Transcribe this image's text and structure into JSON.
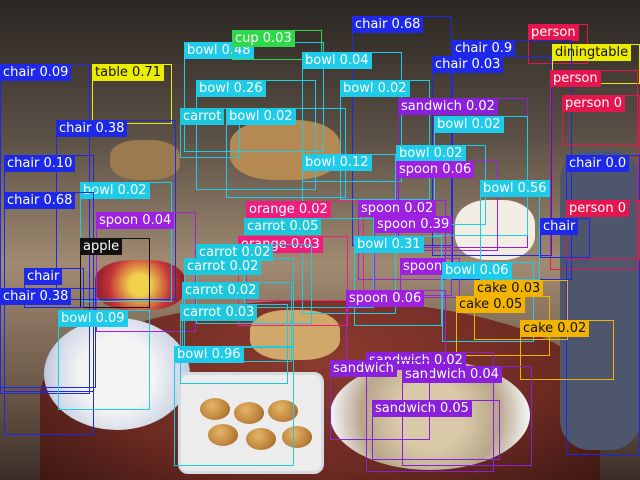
{
  "colors": {
    "chair": "#1d28e8",
    "person": "#e5164f",
    "bowl": "#1ecbe8",
    "diningtable": "#ecec00",
    "cup": "#2ed84a",
    "sandwich": "#8a1fdc",
    "spoon": "#9e20e0",
    "orange": "#ee1e7e",
    "carrot": "#1ec8dc",
    "apple": "#111111",
    "cake": "#f2b400",
    "pizza": "#1e72e8"
  },
  "detections": [
    {
      "cls": "chair",
      "text": "chair 0.68"
    },
    {
      "cls": "person",
      "text": "person"
    },
    {
      "cls": "diningtable",
      "text": "diningtable"
    },
    {
      "cls": "bowl",
      "text": "bowl 0.48"
    },
    {
      "cls": "cup",
      "text": "cup 0.03"
    },
    {
      "cls": "chair",
      "text": "chair 0.9"
    },
    {
      "cls": "bowl",
      "text": "bowl 0.04"
    },
    {
      "cls": "chair",
      "text": "chair 0.03"
    },
    {
      "cls": "chair",
      "text": "chair 0.09"
    },
    {
      "cls": "diningtable",
      "text": "table 0.71"
    },
    {
      "cls": "person",
      "text": "person"
    },
    {
      "cls": "bowl",
      "text": "bowl 0.26"
    },
    {
      "cls": "bowl",
      "text": "bowl 0.02"
    },
    {
      "cls": "person",
      "text": "person 0"
    },
    {
      "cls": "sandwich",
      "text": "sandwich 0.02"
    },
    {
      "cls": "carrot",
      "text": "carrot"
    },
    {
      "cls": "bowl",
      "text": "bowl 0.02"
    },
    {
      "cls": "bowl",
      "text": "bowl 0.02"
    },
    {
      "cls": "chair",
      "text": "chair 0.38"
    },
    {
      "cls": "bowl",
      "text": "bowl 0.12"
    },
    {
      "cls": "bowl",
      "text": "bowl 0.02"
    },
    {
      "cls": "chair",
      "text": "chair 0.10"
    },
    {
      "cls": "chair",
      "text": "chair 0.0"
    },
    {
      "cls": "spoon",
      "text": "spoon 0.06"
    },
    {
      "cls": "bowl",
      "text": "bowl 0.56"
    },
    {
      "cls": "bowl",
      "text": "bowl 0.02"
    },
    {
      "cls": "chair",
      "text": "chair 0.68"
    },
    {
      "cls": "spoon",
      "text": "spoon 0.04"
    },
    {
      "cls": "orange",
      "text": "orange 0.02"
    },
    {
      "cls": "spoon",
      "text": "spoon 0.02"
    },
    {
      "cls": "person",
      "text": "person 0"
    },
    {
      "cls": "carrot",
      "text": "carrot 0.05"
    },
    {
      "cls": "spoon",
      "text": "spoon 0.39"
    },
    {
      "cls": "apple",
      "text": "apple"
    },
    {
      "cls": "chair",
      "text": "chair"
    },
    {
      "cls": "orange",
      "text": "orange 0.03"
    },
    {
      "cls": "bowl",
      "text": "bowl 0.31"
    },
    {
      "cls": "carrot",
      "text": "carrot 0.02"
    },
    {
      "cls": "carrot",
      "text": "carrot 0.02"
    },
    {
      "cls": "spoon",
      "text": "spoon"
    },
    {
      "cls": "bowl",
      "text": "bowl 0.06"
    },
    {
      "cls": "chair",
      "text": "chair"
    },
    {
      "cls": "cake",
      "text": "cake 0.03"
    },
    {
      "cls": "carrot",
      "text": "carrot 0.02"
    },
    {
      "cls": "chair",
      "text": "chair 0.38"
    },
    {
      "cls": "spoon",
      "text": "spoon 0.06"
    },
    {
      "cls": "cake",
      "text": "cake 0.05"
    },
    {
      "cls": "carrot",
      "text": "carrot 0.03"
    },
    {
      "cls": "bowl",
      "text": "bowl 0.09"
    },
    {
      "cls": "cake",
      "text": "cake 0.02"
    },
    {
      "cls": "bowl",
      "text": "bowl 0.96"
    },
    {
      "cls": "sandwich",
      "text": "sandwich 0.02"
    },
    {
      "cls": "sandwich",
      "text": "sandwich 0.04"
    },
    {
      "cls": "sandwich",
      "text": "sandwich"
    },
    {
      "cls": "sandwich",
      "text": "sandwich 0.05"
    }
  ]
}
